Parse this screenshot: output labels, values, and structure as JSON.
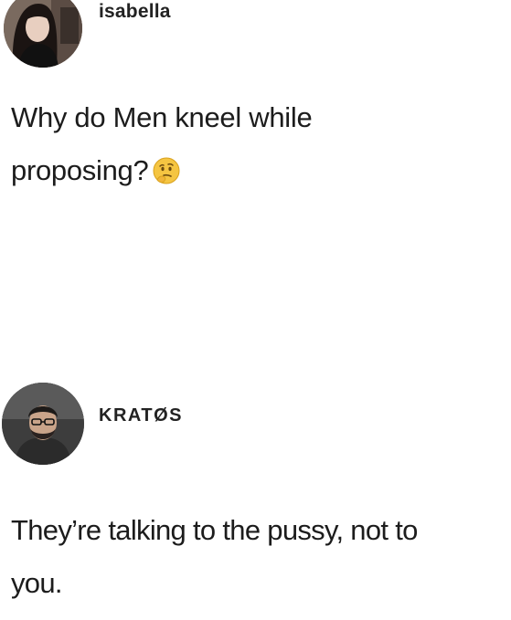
{
  "posts": [
    {
      "username": "isabella",
      "text_line1": "Why do Men kneel while",
      "text_line2": "proposing?",
      "emoji_icon": "thinking-face-icon"
    },
    {
      "username": "KRATØS",
      "text_line1": "They’re talking to the pussy, not to",
      "text_line2": "you."
    }
  ]
}
